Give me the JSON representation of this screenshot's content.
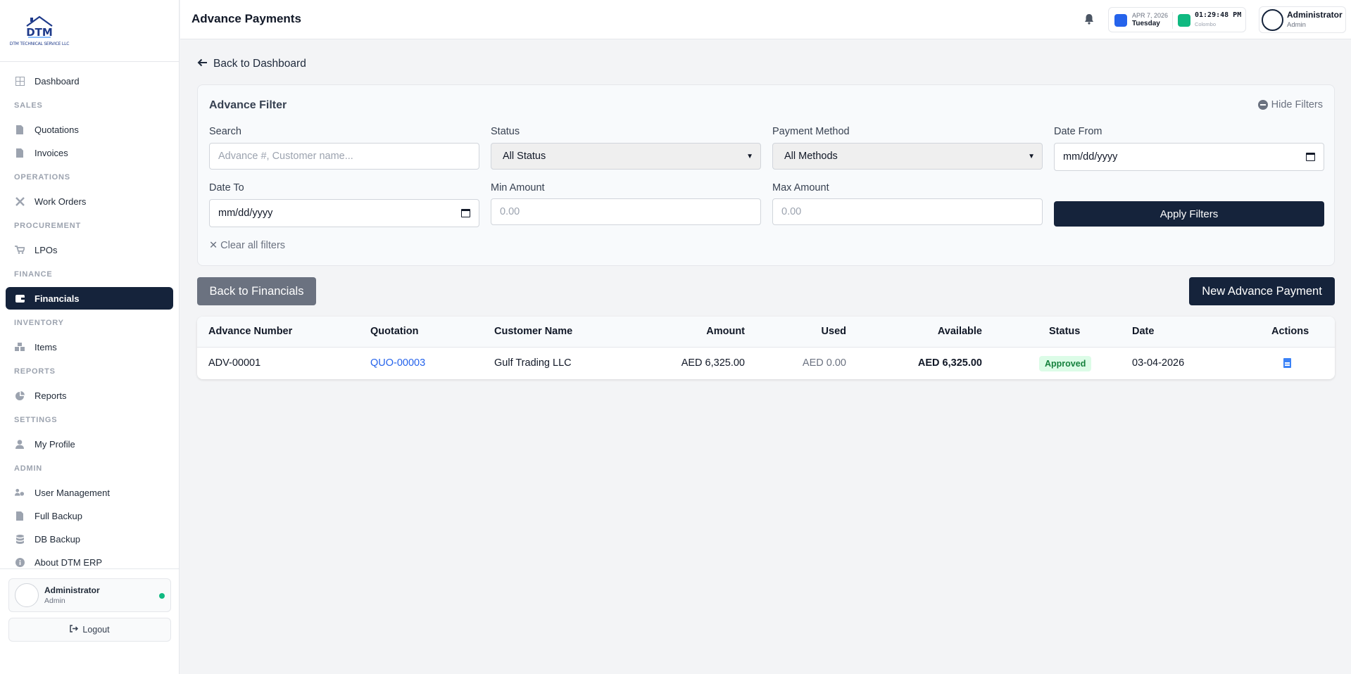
{
  "sidebar": {
    "logo_text": "DTM TECHNICAL SERVICE LLC",
    "items": {
      "dashboard": "Dashboard",
      "sec_sales": "SALES",
      "quotations": "Quotations",
      "invoices": "Invoices",
      "sec_operations": "OPERATIONS",
      "work_orders": "Work Orders",
      "sec_procurement": "PROCUREMENT",
      "lpos": "LPOs",
      "sec_finance": "FINANCE",
      "financials": "Financials",
      "sec_inventory": "INVENTORY",
      "items": "Items",
      "sec_reports": "REPORTS",
      "reports": "Reports",
      "sec_settings": "SETTINGS",
      "my_profile": "My Profile",
      "sec_admin": "ADMIN",
      "user_management": "User Management",
      "full_backup": "Full Backup",
      "db_backup": "DB Backup",
      "about": "About DTM ERP"
    },
    "user": {
      "name": "Administrator",
      "role": "Admin"
    },
    "logout": "Logout"
  },
  "header": {
    "title": "Advance Payments",
    "date": "APR 7, 2026",
    "day": "Tuesday",
    "time": "01:29:48 PM",
    "zone": "Colombo",
    "user": {
      "name": "Administrator",
      "role": "Admin"
    }
  },
  "main": {
    "back_link": "Back to Dashboard",
    "filter": {
      "title": "Advance Filter",
      "hide": "Hide Filters",
      "search_label": "Search",
      "search_placeholder": "Advance #, Customer name...",
      "status_label": "Status",
      "status_value": "All Status",
      "method_label": "Payment Method",
      "method_value": "All Methods",
      "date_from_label": "Date From",
      "date_from_value": "mm/dd/yyyy",
      "date_to_label": "Date To",
      "date_to_value": "mm/dd/yyyy",
      "min_label": "Min Amount",
      "min_placeholder": "0.00",
      "max_label": "Max Amount",
      "max_placeholder": "0.00",
      "apply": "Apply Filters",
      "clear": "✕ Clear all filters"
    },
    "back_financials": "Back to Financials",
    "new_advance": "New Advance Payment",
    "table": {
      "headers": {
        "number": "Advance Number",
        "quotation": "Quotation",
        "customer": "Customer Name",
        "amount": "Amount",
        "used": "Used",
        "available": "Available",
        "status": "Status",
        "date": "Date",
        "actions": "Actions"
      },
      "rows": [
        {
          "number": "ADV-00001",
          "quotation": "QUO-00003",
          "customer": "Gulf Trading LLC",
          "amount": "AED 6,325.00",
          "used": "AED 0.00",
          "available": "AED 6,325.00",
          "status": "Approved",
          "date": "03-04-2026",
          "action_icon": "document-icon"
        }
      ]
    }
  }
}
